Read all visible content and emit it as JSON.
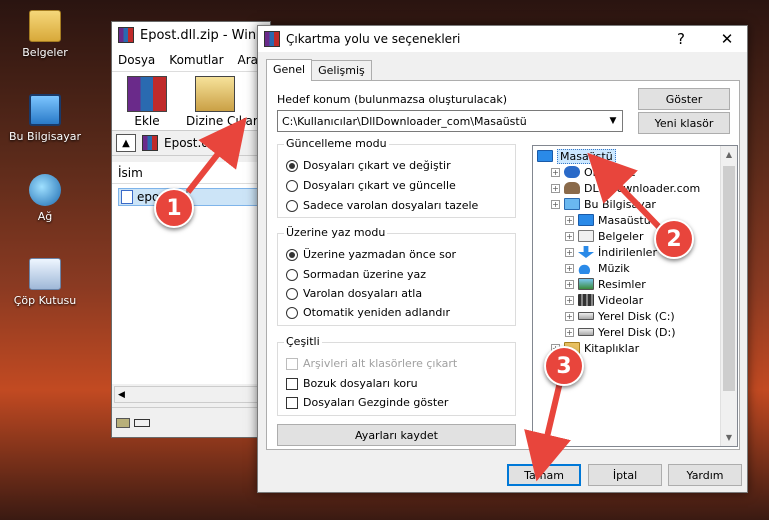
{
  "desktop": {
    "icons": [
      {
        "label": "Belgeler"
      },
      {
        "label": "Bu Bilgisayar"
      },
      {
        "label": "Ağ"
      },
      {
        "label": "Çöp Kutusu"
      }
    ]
  },
  "winrar": {
    "title": "Epost.dll.zip - WinRAR",
    "menu": [
      "Dosya",
      "Komutlar",
      "Araçlar"
    ],
    "toolbar": {
      "add": "Ekle",
      "extract": "Dizine Çıkart"
    },
    "path": "Epost.dll.zip",
    "list_header": "İsim",
    "selected_file": "epost.dll"
  },
  "dialog": {
    "title": "Çıkartma yolu ve seçenekleri",
    "help": "?",
    "close": "✕",
    "tabs": [
      "Genel",
      "Gelişmiş"
    ],
    "dest_label": "Hedef konum (bulunmazsa oluşturulacak)",
    "dest_value": "C:\\Kullanıcılar\\DllDownloader_com\\Masaüstü",
    "show_button": "Göster",
    "new_folder_button": "Yeni klasör",
    "update_mode": {
      "title": "Güncelleme modu",
      "options": [
        "Dosyaları çıkart ve değiştir",
        "Dosyaları çıkart ve güncelle",
        "Sadece varolan dosyaları tazele"
      ],
      "selected": 0
    },
    "overwrite_mode": {
      "title": "Üzerine yaz modu",
      "options": [
        "Üzerine yazmadan önce sor",
        "Sormadan üzerine yaz",
        "Varolan dosyaları atla",
        "Otomatik yeniden adlandır"
      ],
      "selected": 0
    },
    "misc": {
      "title": "Çeşitli",
      "options": [
        "Arşivleri alt klasörlere çıkart",
        "Bozuk dosyaları koru",
        "Dosyaları Gezginde göster"
      ]
    },
    "save_settings": "Ayarları kaydet",
    "tree": [
      {
        "label": "Masaüstü",
        "level": 0,
        "icon": "desktop-icon"
      },
      {
        "label": "OneDrive",
        "level": 1,
        "icon": "cloud-icon"
      },
      {
        "label": "DLL Downloader.com",
        "level": 1,
        "icon": "user-icon"
      },
      {
        "label": "Bu Bilgisayar",
        "level": 1,
        "icon": "computer-icon"
      },
      {
        "label": "Masaüstü",
        "level": 2,
        "icon": "desktop-icon"
      },
      {
        "label": "Belgeler",
        "level": 2,
        "icon": "documents-icon"
      },
      {
        "label": "İndirilenler",
        "level": 2,
        "icon": "download-icon"
      },
      {
        "label": "Müzik",
        "level": 2,
        "icon": "music-icon"
      },
      {
        "label": "Resimler",
        "level": 2,
        "icon": "pictures-icon"
      },
      {
        "label": "Videolar",
        "level": 2,
        "icon": "videos-icon"
      },
      {
        "label": "Yerel Disk (C:)",
        "level": 2,
        "icon": "disk-icon"
      },
      {
        "label": "Yerel Disk (D:)",
        "level": 2,
        "icon": "disk-icon"
      },
      {
        "label": "Kitaplıklar",
        "level": 1,
        "icon": "library-icon"
      }
    ],
    "ok": "Tamam",
    "cancel": "İptal",
    "helpbtn": "Yardım"
  },
  "annotations": [
    "1",
    "2",
    "3"
  ],
  "colors": {
    "callout": "#e8453c",
    "accent": "#0078d7"
  }
}
